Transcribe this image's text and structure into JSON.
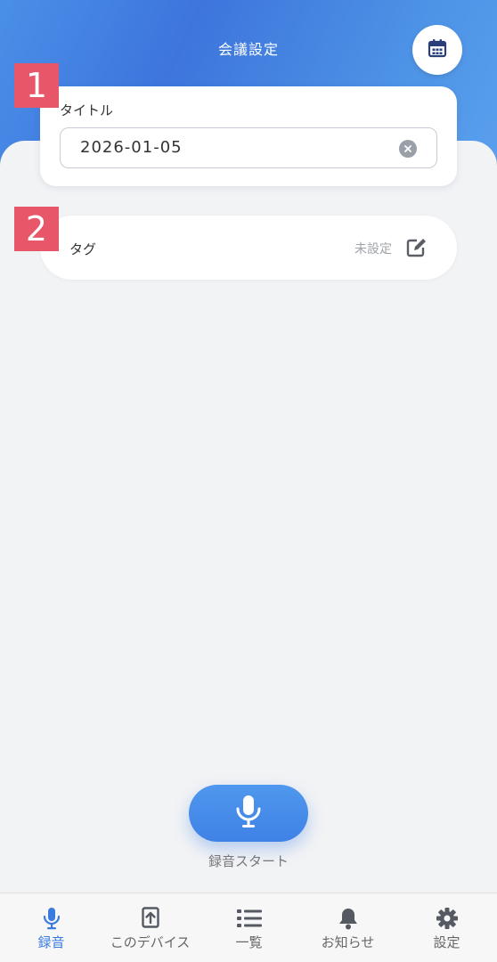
{
  "header": {
    "title": "会議設定",
    "calendar_icon": "calendar-icon"
  },
  "badges": {
    "one": "1",
    "two": "2"
  },
  "title_section": {
    "label": "タイトル",
    "value": "2026-01-05",
    "clear_icon": "clear-icon"
  },
  "tag_section": {
    "label": "タグ",
    "status": "未設定",
    "edit_icon": "edit-icon"
  },
  "record": {
    "label": "録音スタート",
    "icon": "microphone-icon"
  },
  "tabs": [
    {
      "label": "録音",
      "icon": "microphone-icon",
      "active": true
    },
    {
      "label": "このデバイス",
      "icon": "upload-icon",
      "active": false
    },
    {
      "label": "一覧",
      "icon": "list-icon",
      "active": false
    },
    {
      "label": "お知らせ",
      "icon": "bell-icon",
      "active": false
    },
    {
      "label": "設定",
      "icon": "gear-icon",
      "active": false
    }
  ],
  "colors": {
    "accent": "#3a7be0",
    "badge": "#e8566a",
    "header_gradient_start": "#4a8fe8",
    "header_gradient_end": "#5aa0ee"
  }
}
